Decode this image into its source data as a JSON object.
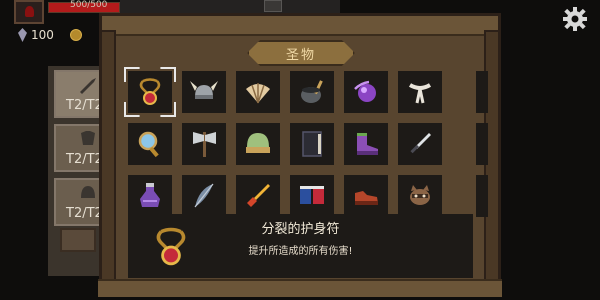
{
  "hud": {
    "hp_text": "500/500",
    "hp_fraction": 1.0,
    "gems": "100"
  },
  "side_tabs": [
    {
      "label": "T2/T2",
      "icon": "sword-icon"
    },
    {
      "label": "T2/T2",
      "icon": "chestplate-icon"
    },
    {
      "label": "T2/T2",
      "icon": "helmet-icon"
    }
  ],
  "window": {
    "title": "圣物"
  },
  "relics": [
    {
      "name": "amulet-icon",
      "selected": true
    },
    {
      "name": "horned-helmet-icon"
    },
    {
      "name": "fan-icon"
    },
    {
      "name": "cauldron-icon"
    },
    {
      "name": "purple-orb-icon"
    },
    {
      "name": "bone-horn-icon"
    },
    {
      "name": "magnifier-icon"
    },
    {
      "name": "double-axe-icon"
    },
    {
      "name": "green-dome-icon"
    },
    {
      "name": "spellbook-icon"
    },
    {
      "name": "purple-boot-icon"
    },
    {
      "name": "dagger-icon"
    },
    {
      "name": "purple-potion-icon"
    },
    {
      "name": "feather-icon"
    },
    {
      "name": "fire-sword-icon"
    },
    {
      "name": "calendar-icon"
    },
    {
      "name": "red-shoe-icon"
    },
    {
      "name": "raccoon-icon"
    }
  ],
  "detail": {
    "name": "分裂的护身符",
    "description": "提升所造成的所有伤害!"
  },
  "colors": {
    "frame": "#58452f",
    "slot": "#1d1a17",
    "title_plate": "#8c6f3e",
    "selection": "#e9e9e9"
  }
}
